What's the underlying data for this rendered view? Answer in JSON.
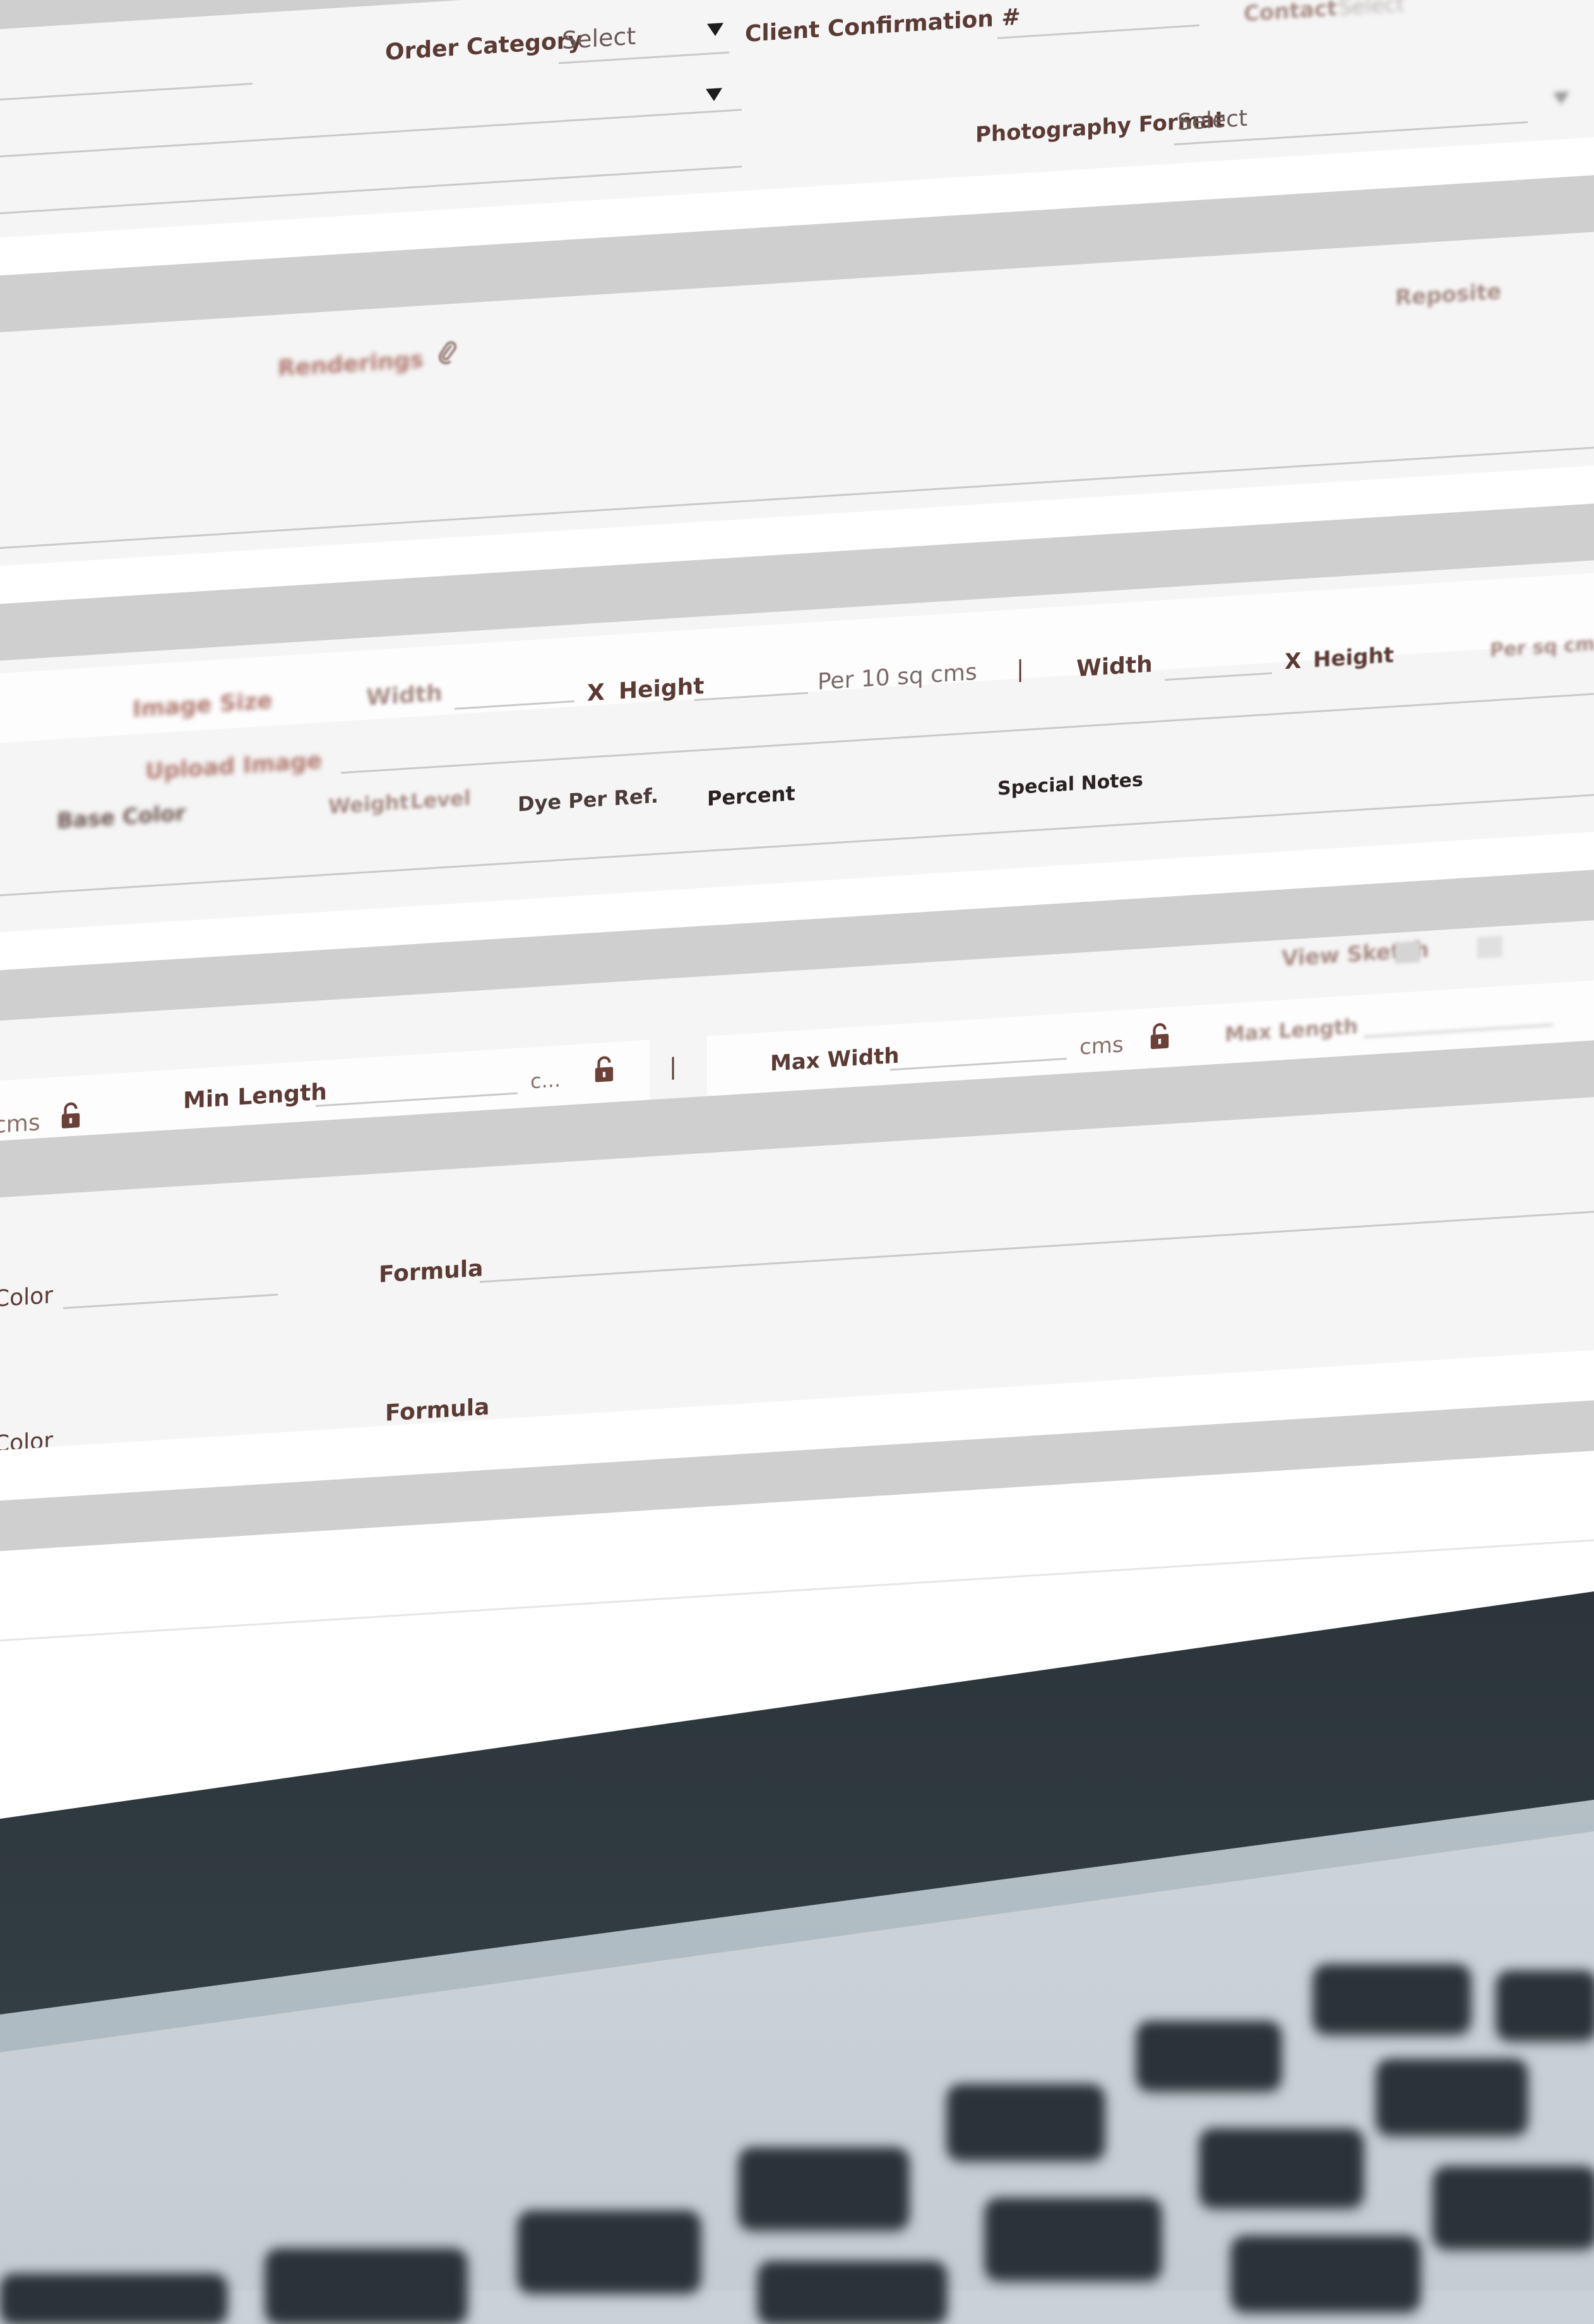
{
  "order": {
    "order_category_label": "Order Category",
    "order_category_value": "Select",
    "client_confirmation_label": "Client Confirmation #",
    "contact_label": "Contact",
    "contact_value": "Select",
    "photography_format_label": "Photography Format",
    "photography_format_value": "Select"
  },
  "attachments": {
    "renderings_label": "Renderings",
    "top_right_link": "Reposite"
  },
  "dimensions": {
    "image_size_label": "Image Size",
    "width_label": "Width",
    "x_label": "X",
    "height_label": "Height",
    "per_unit": "Per 10 sq cms",
    "divider": "|",
    "width_label_2": "Width",
    "x_label_2": "X",
    "height_label_2": "Height",
    "upload_image_label": "Upload Image",
    "far_right_blur": "Per sq cm"
  },
  "dye": {
    "row_label": "Base Color",
    "weight_label": "Weight",
    "level_label": "Level",
    "dye_per_ref_label": "Dye Per Ref.",
    "percent_label": "Percent",
    "special_notes_label": "Special Notes"
  },
  "size_limits": {
    "view_sketch_label": "View Sketch",
    "cms_left": "cms",
    "min_length_label": "Min Length",
    "min_length_unit": "c...",
    "divider": "|",
    "max_width_label": "Max Width",
    "max_width_unit": "cms",
    "max_length_label": "Max Length"
  },
  "colors_section": {
    "color_label_1": "Color",
    "formula_label_1": "Formula",
    "color_label_2": "Color",
    "formula_label_2": "Formula"
  },
  "theme": {
    "label_color": "#5b3a34",
    "panel_bg": "#f5f5f5",
    "band_bg": "#cfcfcf",
    "bezel": "#1e262b",
    "keys": "#2b3338"
  },
  "icons": [
    "dropdown-arrow-icon",
    "paperclip-icon",
    "unlock-icon"
  ]
}
